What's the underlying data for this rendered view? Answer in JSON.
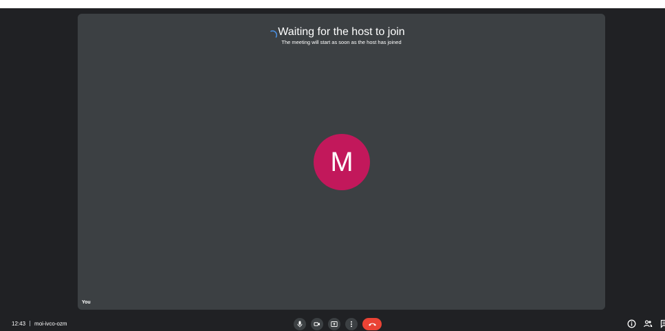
{
  "stage": {
    "waiting_title": "Waiting for the host to join",
    "waiting_subtitle": "The meeting will start as soon as the host has joined",
    "avatar_initial": "M",
    "avatar_color": "#c2185b",
    "self_label": "You"
  },
  "bottom_bar": {
    "time": "12:43",
    "meeting_code": "moi-ivco-ozm",
    "controls": [
      "microphone-icon",
      "camera-icon",
      "present-screen-icon",
      "more-options-icon",
      "end-call-icon"
    ],
    "end_call_color": "#ea4335",
    "right_icons": [
      "info-icon",
      "people-icon",
      "chat-icon"
    ]
  }
}
